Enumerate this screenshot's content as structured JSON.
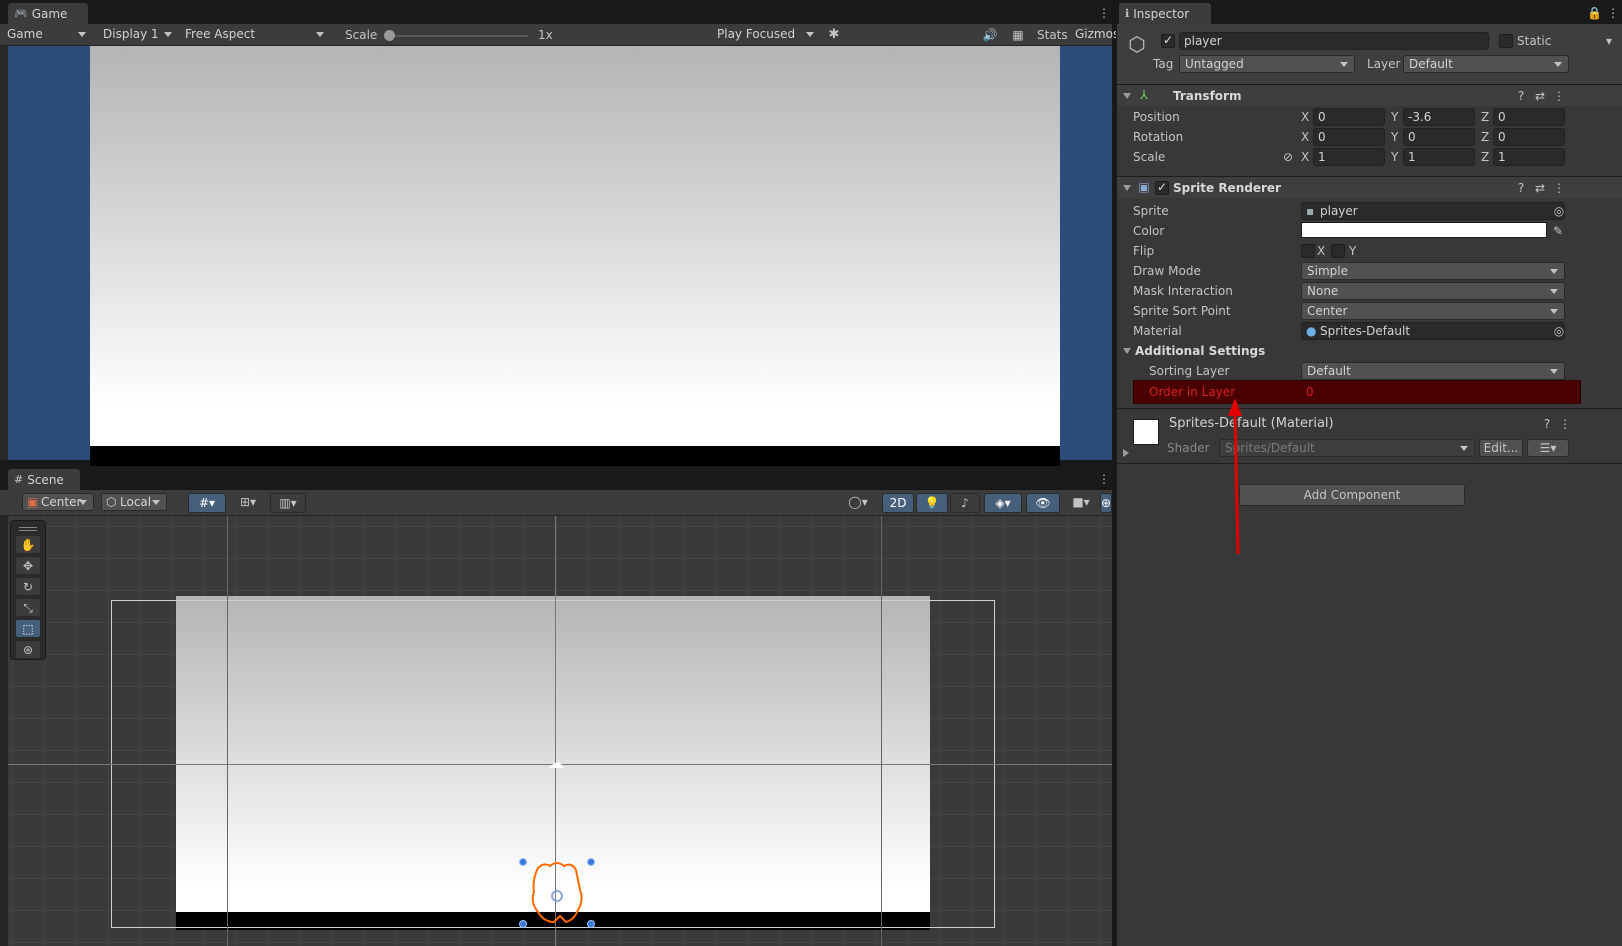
{
  "game": {
    "tab_label": "Game",
    "toolbar": {
      "view": "Game",
      "display": "Display 1",
      "aspect": "Free Aspect",
      "scale_label": "Scale",
      "scale_value": "1x",
      "play_mode": "Play Focused",
      "stats": "Stats",
      "gizmos": "Gizmos"
    }
  },
  "scene": {
    "tab_label": "Scene",
    "toolbar": {
      "pivot": "Center",
      "space": "Local",
      "mode_2d": "2D"
    },
    "tools": [
      "hand-tool-icon",
      "move-tool-icon",
      "rotate-tool-icon",
      "scale-tool-icon",
      "rect-tool-icon",
      "transform-tool-icon"
    ]
  },
  "inspector": {
    "tab_label": "Inspector",
    "object_name": "player",
    "static_label": "Static",
    "tag_label": "Tag",
    "tag_value": "Untagged",
    "layer_label": "Layer",
    "layer_value": "Default",
    "transform": {
      "title": "Transform",
      "position_label": "Position",
      "rotation_label": "Rotation",
      "scale_label": "Scale",
      "x": "X",
      "y": "Y",
      "z": "Z",
      "position": [
        "0",
        "-3.6",
        "0"
      ],
      "rotation": [
        "0",
        "0",
        "0"
      ],
      "scale": [
        "1",
        "1",
        "1"
      ]
    },
    "sprite_renderer": {
      "title": "Sprite Renderer",
      "sprite_label": "Sprite",
      "sprite_value": "player",
      "color_label": "Color",
      "color_value": "#ffffff",
      "flip_label": "Flip",
      "flip_x": "X",
      "flip_y": "Y",
      "draw_mode_label": "Draw Mode",
      "draw_mode_value": "Simple",
      "mask_label": "Mask Interaction",
      "mask_value": "None",
      "sort_point_label": "Sprite Sort Point",
      "sort_point_value": "Center",
      "material_label": "Material",
      "material_value": "Sprites-Default",
      "additional_label": "Additional Settings",
      "sorting_layer_label": "Sorting Layer",
      "sorting_layer_value": "Default",
      "order_label": "Order in Layer",
      "order_value": "0"
    },
    "material": {
      "title": "Sprites-Default (Material)",
      "shader_label": "Shader",
      "shader_value": "Sprites/Default",
      "edit_label": "Edit..."
    },
    "add_component": "Add Component"
  },
  "colors": {
    "game_bg": "#2d4c79",
    "selection_outline": "#ff6a00",
    "highlight_row": "#4a0000",
    "highlight_text": "#d42020",
    "annotation_arrow": "#e00000"
  }
}
